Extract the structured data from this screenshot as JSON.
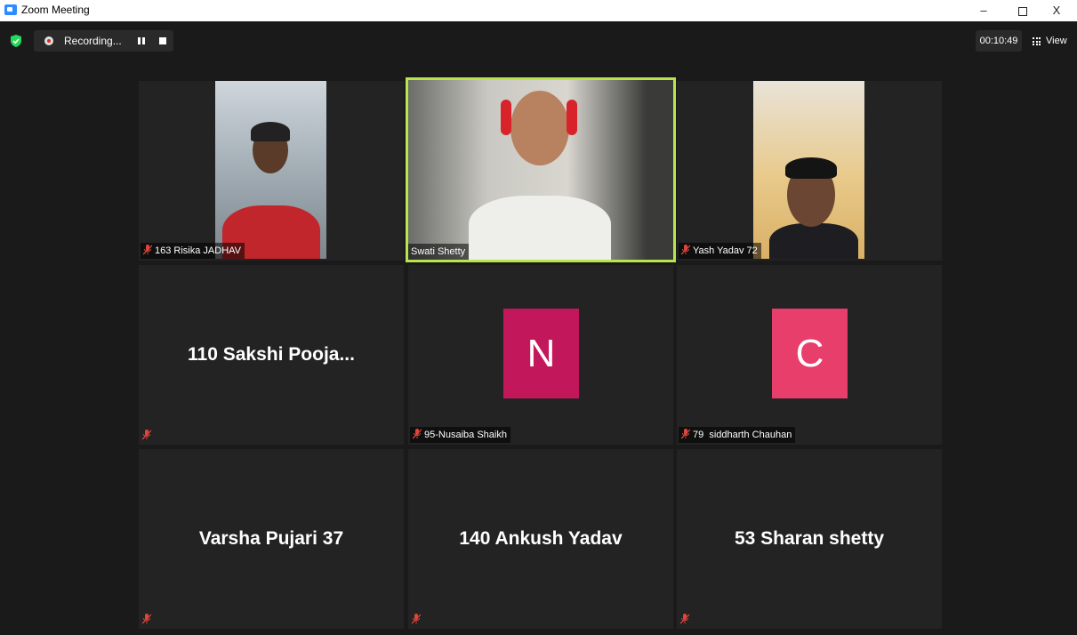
{
  "window": {
    "title": "Zoom Meeting",
    "minimize": "–",
    "close": "X"
  },
  "toolbar": {
    "recording_label": "Recording...",
    "timer": "00:10:49",
    "view_label": "View"
  },
  "colors": {
    "active_speaker_border": "#b9e54a",
    "avatar_n": "#c2185b",
    "avatar_c": "#e83e6c",
    "muted_icon": "#e0443a"
  },
  "participants": [
    {
      "display_name": "163 Risika JADHAV",
      "video": true,
      "muted": true
    },
    {
      "display_name": "Swati Shetty",
      "video": true,
      "muted": false,
      "active_speaker": true
    },
    {
      "display_name": "Yash Yadav 72",
      "video": true,
      "muted": true
    },
    {
      "display_name": "110 Sakshi Pooja...",
      "video": false,
      "muted": true
    },
    {
      "display_name": "95-Nusaiba Shaikh",
      "video": false,
      "avatar_letter": "N",
      "muted": true
    },
    {
      "display_name": "79  siddharth Chauhan",
      "video": false,
      "avatar_letter": "C",
      "muted": true
    },
    {
      "display_name": "Varsha Pujari 37",
      "video": false,
      "muted": true
    },
    {
      "display_name": "140 Ankush Yadav",
      "video": false,
      "muted": true
    },
    {
      "display_name": "53 Sharan shetty",
      "video": false,
      "muted": true
    }
  ]
}
